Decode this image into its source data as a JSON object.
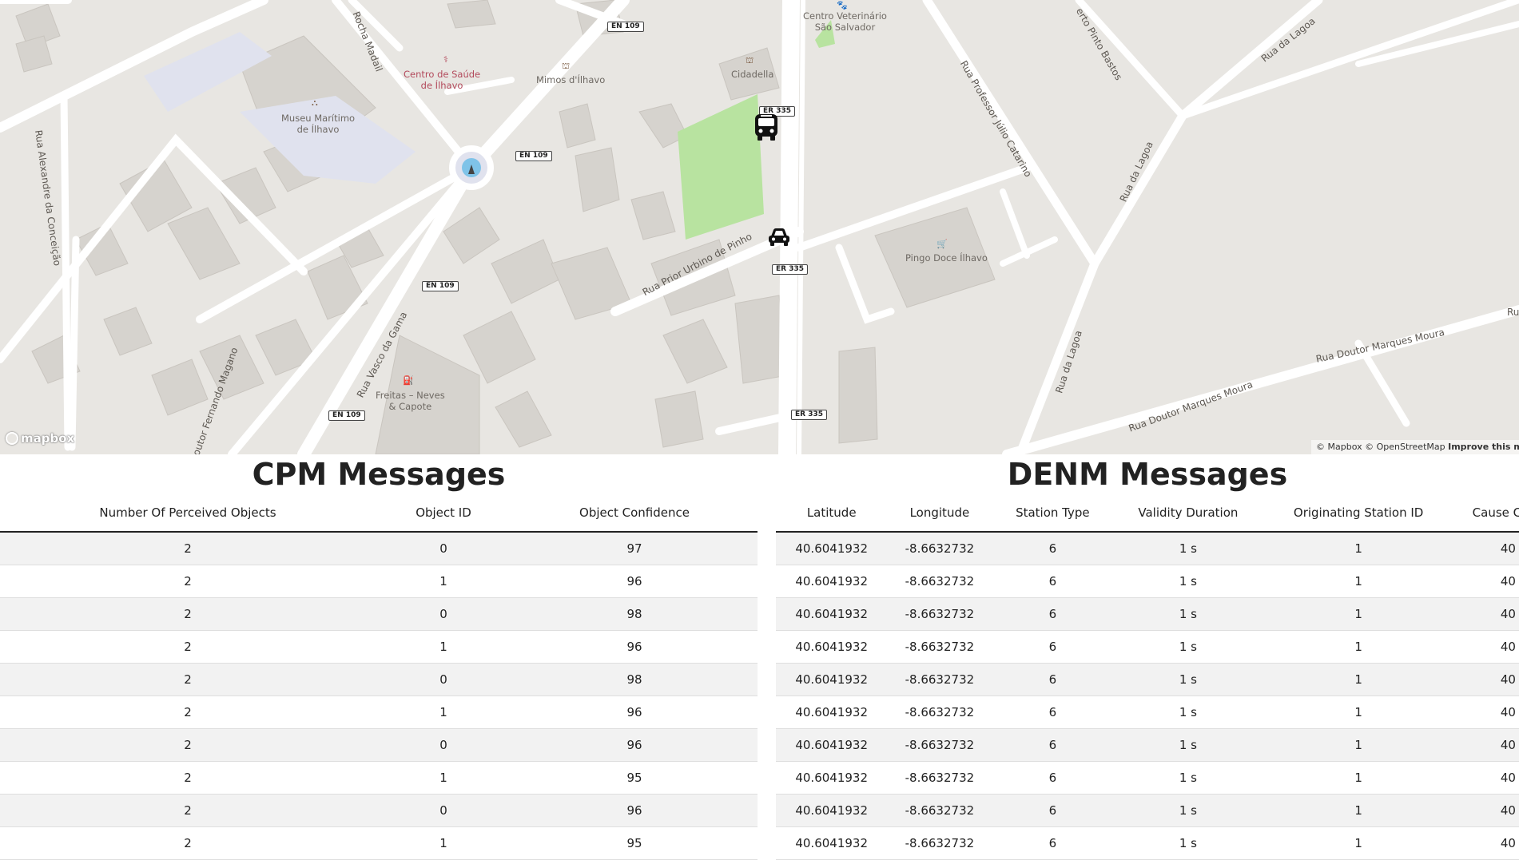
{
  "map": {
    "street_labels": [
      "Rua Alexandre da Conceição",
      "Rocha Madail",
      "Rua Vasco da Gama",
      "outor Fernando Magano",
      "Rua Prior Urbino de Pinho",
      "Rua Professor Júlio Catarino",
      "erto Pinto Bastos",
      "Rua da Lagoa",
      "Rua da Lagoa",
      "Rua da Lagoa",
      "Rua Doutor Marques Moura",
      "Rua Doutor Marques Moura",
      "Ru"
    ],
    "road_shields": [
      "EN 109",
      "EN 109",
      "EN 109",
      "EN 109",
      "ER 335",
      "ER 335",
      "ER 335"
    ],
    "pois": {
      "saude": "Centro de Saúde\nde Ílhavo",
      "mimos": "Mimos d'Ílhavo",
      "museu": "Museu Marítimo\nde Ílhavo",
      "cidadella": "Cidadella",
      "veterinario": "Centro Veterinário\nSão Salvador",
      "pingo": "Pingo Doce Ílhavo",
      "freitas": "Freitas – Neves\n& Capote"
    },
    "logo_text": "mapbox",
    "attribution": {
      "text": "© Mapbox © OpenStreetMap",
      "improve": "Improve this m"
    },
    "vehicle_icons": [
      "bus-icon",
      "car-icon"
    ],
    "colors": {
      "park": "#b8e3a0",
      "road": "#ffffff",
      "land": "#e8e6e2",
      "building": "#d6d3ce"
    }
  },
  "cpm": {
    "title": "CPM Messages",
    "columns": [
      "Number Of Perceived Objects",
      "Object ID",
      "Object Confidence"
    ],
    "rows": [
      [
        "2",
        "0",
        "97"
      ],
      [
        "2",
        "1",
        "96"
      ],
      [
        "2",
        "0",
        "98"
      ],
      [
        "2",
        "1",
        "96"
      ],
      [
        "2",
        "0",
        "98"
      ],
      [
        "2",
        "1",
        "96"
      ],
      [
        "2",
        "0",
        "96"
      ],
      [
        "2",
        "1",
        "95"
      ],
      [
        "2",
        "0",
        "96"
      ],
      [
        "2",
        "1",
        "95"
      ]
    ]
  },
  "denm": {
    "title": "DENM Messages",
    "columns": [
      "Latitude",
      "Longitude",
      "Station Type",
      "Validity Duration",
      "Originating Station ID",
      "Cause Code"
    ],
    "rows": [
      [
        "40.6041932",
        "-8.6632732",
        "6",
        "1 s",
        "1",
        "40"
      ],
      [
        "40.6041932",
        "-8.6632732",
        "6",
        "1 s",
        "1",
        "40"
      ],
      [
        "40.6041932",
        "-8.6632732",
        "6",
        "1 s",
        "1",
        "40"
      ],
      [
        "40.6041932",
        "-8.6632732",
        "6",
        "1 s",
        "1",
        "40"
      ],
      [
        "40.6041932",
        "-8.6632732",
        "6",
        "1 s",
        "1",
        "40"
      ],
      [
        "40.6041932",
        "-8.6632732",
        "6",
        "1 s",
        "1",
        "40"
      ],
      [
        "40.6041932",
        "-8.6632732",
        "6",
        "1 s",
        "1",
        "40"
      ],
      [
        "40.6041932",
        "-8.6632732",
        "6",
        "1 s",
        "1",
        "40"
      ],
      [
        "40.6041932",
        "-8.6632732",
        "6",
        "1 s",
        "1",
        "40"
      ],
      [
        "40.6041932",
        "-8.6632732",
        "6",
        "1 s",
        "1",
        "40"
      ]
    ]
  }
}
